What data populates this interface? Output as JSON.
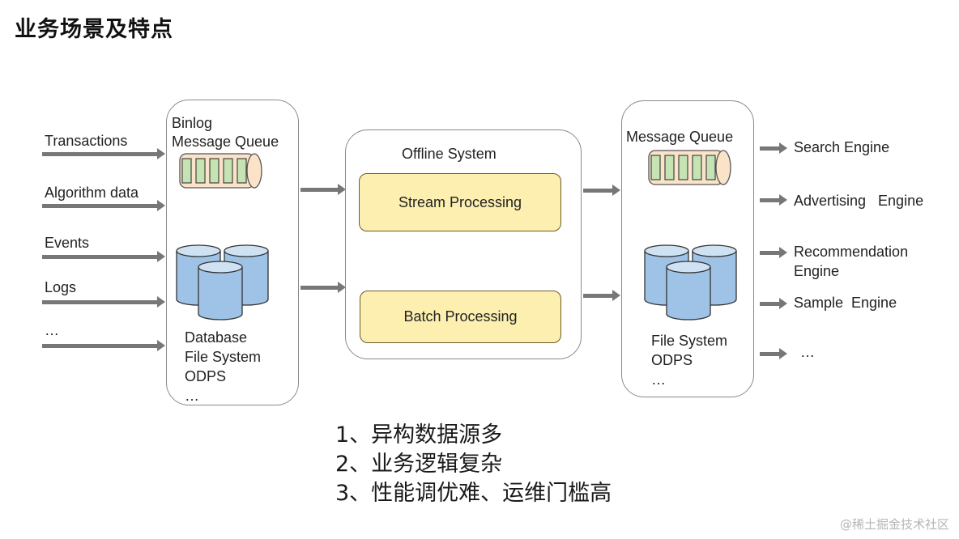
{
  "title": "业务场景及特点",
  "sources": {
    "items": [
      "Transactions",
      "Algorithm data",
      "Events",
      "Logs",
      "…"
    ]
  },
  "ingest_panel": {
    "queue_label_line1": "Binlog",
    "queue_label_line2": "Message Queue",
    "storage_lines": [
      "Database",
      "File System",
      "ODPS",
      "…"
    ]
  },
  "offline_system": {
    "title": "Offline  System",
    "stream": "Stream Processing",
    "batch": "Batch Processing"
  },
  "output_panel": {
    "queue_label": "Message Queue",
    "storage_lines": [
      "File System",
      "ODPS",
      "…"
    ]
  },
  "consumers": {
    "items": [
      "Search Engine",
      "Advertising   Engine",
      "Recommendation",
      "Engine",
      "Sample  Engine",
      "…"
    ]
  },
  "characteristics": [
    "1、异构数据源多",
    "2、业务逻辑复杂",
    "3、性能调优难、运维门槛高"
  ],
  "watermark": "@稀土掘金技术社区",
  "colors": {
    "queue_body": "#fbe3c9",
    "queue_slot": "#c6e3b4",
    "db_fill": "#9ec3e6",
    "db_top": "#cfe2f3",
    "process_fill": "#fcefb0",
    "arrow": "#777777"
  }
}
